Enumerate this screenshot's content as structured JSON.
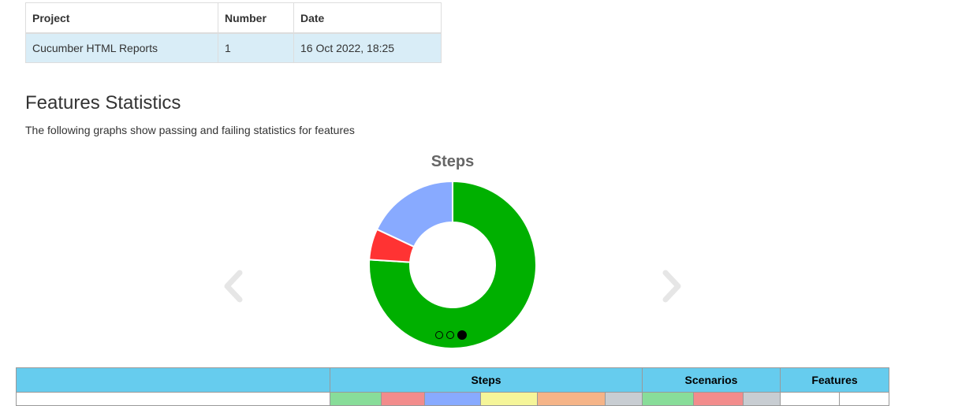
{
  "report_info": {
    "headers": [
      "Project",
      "Number",
      "Date"
    ],
    "row": {
      "project": "Cucumber HTML Reports",
      "number": "1",
      "date": "16 Oct 2022, 18:25"
    }
  },
  "features_statistics": {
    "title": "Features Statistics",
    "description": "The following graphs show passing and failing statistics for features"
  },
  "carousel": {
    "active_slide": 3,
    "slide_count": 3,
    "prev_icon": "chevron-left-icon",
    "next_icon": "chevron-right-icon"
  },
  "chart_data": {
    "type": "pie",
    "title": "Steps",
    "donut": true,
    "labels": [],
    "values": [
      76,
      6,
      18
    ],
    "colors": [
      "#00b000",
      "#ff3333",
      "#88aaff"
    ]
  },
  "stats_table": {
    "group_headers": {
      "label": "",
      "steps": "Steps",
      "scenarios": "Scenarios",
      "features": "Features"
    },
    "subheader_colors": {
      "steps": [
        "#88dd99",
        "#f28c8c",
        "#88aaff",
        "#f5f599",
        "#f5b488",
        "#c8cdd2"
      ],
      "scenarios": [
        "#88dd99",
        "#f28c8c",
        "#c8cdd2"
      ],
      "features": [
        "#ffffff",
        "#ffffff"
      ]
    }
  }
}
